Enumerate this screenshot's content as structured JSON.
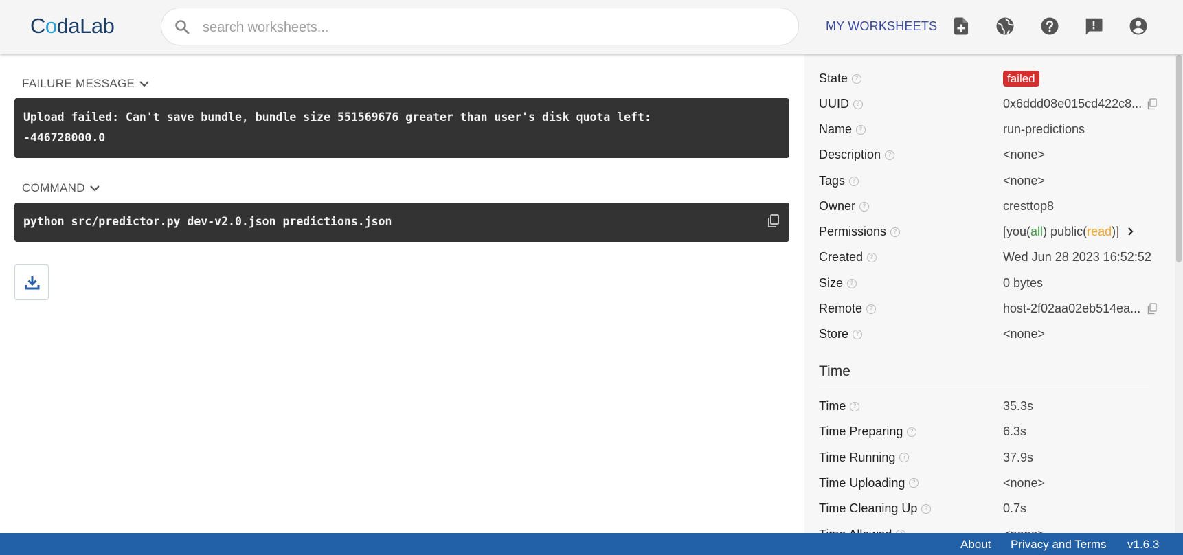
{
  "header": {
    "logo": {
      "pre": "C",
      "o": "o",
      "post": "daLab"
    },
    "search_placeholder": "search worksheets...",
    "nav_link": "MY WORKSHEETS",
    "icons": [
      "new-worksheet-icon",
      "globe-icon",
      "help-icon",
      "feedback-icon",
      "account-icon"
    ]
  },
  "failure": {
    "label": "FAILURE MESSAGE",
    "line1": "Upload failed: Can't save bundle, bundle size 551569676 greater than user's disk quota left:",
    "line2": "-446728000.0"
  },
  "command": {
    "label": "COMMAND",
    "text": "python src/predictor.py dev-v2.0.json predictions.json"
  },
  "details": {
    "state": {
      "label": "State",
      "value": "failed"
    },
    "uuid": {
      "label": "UUID",
      "value": "0x6ddd08e015cd422c8..."
    },
    "name": {
      "label": "Name",
      "value": "run-predictions"
    },
    "description": {
      "label": "Description",
      "value": "<none>"
    },
    "tags": {
      "label": "Tags",
      "value": "<none>"
    },
    "owner": {
      "label": "Owner",
      "value": "cresttop8"
    },
    "permissions": {
      "label": "Permissions",
      "open": "[you(",
      "you_perm": "all",
      "mid": ") public(",
      "public_perm": "read",
      "close": ")]"
    },
    "created": {
      "label": "Created",
      "value": "Wed Jun 28 2023 16:52:52"
    },
    "size": {
      "label": "Size",
      "value": "0 bytes"
    },
    "remote": {
      "label": "Remote",
      "value": "host-2f02aa02eb514ea..."
    },
    "store": {
      "label": "Store",
      "value": "<none>"
    }
  },
  "time_section": {
    "title": "Time",
    "rows": [
      {
        "label": "Time",
        "value": "35.3s",
        "muted": false
      },
      {
        "label": "Time Preparing",
        "value": "6.3s",
        "muted": false
      },
      {
        "label": "Time Running",
        "value": "37.9s",
        "muted": false
      },
      {
        "label": "Time Uploading",
        "value": "<none>",
        "muted": true
      },
      {
        "label": "Time Cleaning Up",
        "value": "0.7s",
        "muted": false
      },
      {
        "label": "Time Allowed",
        "value": "<none>",
        "muted": true
      }
    ]
  },
  "footer": {
    "about": "About",
    "privacy": "Privacy and Terms",
    "version": "v1.6.3"
  },
  "colors": {
    "header_bg": "#f5f5f5",
    "footer_bg": "#2261a8",
    "failed_badge": "#d32f2f",
    "link": "#2b5fa8",
    "nav_link": "#3a4a9c"
  }
}
